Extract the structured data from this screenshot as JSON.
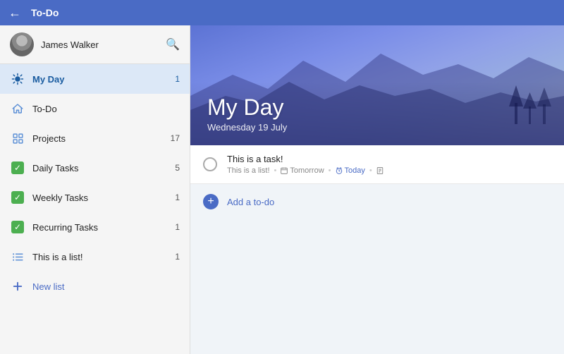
{
  "topbar": {
    "title": "To-Do"
  },
  "sidebar": {
    "user": {
      "name": "James Walker"
    },
    "items": [
      {
        "id": "my-day",
        "label": "My Day",
        "icon": "sun",
        "count": "1",
        "active": true
      },
      {
        "id": "to-do",
        "label": "To-Do",
        "icon": "house",
        "count": "",
        "active": false
      },
      {
        "id": "projects",
        "label": "Projects",
        "icon": "grid",
        "count": "17",
        "active": false
      },
      {
        "id": "daily-tasks",
        "label": "Daily Tasks",
        "icon": "check",
        "count": "5",
        "active": false
      },
      {
        "id": "weekly-tasks",
        "label": "Weekly Tasks",
        "icon": "check",
        "count": "1",
        "active": false
      },
      {
        "id": "recurring-tasks",
        "label": "Recurring Tasks",
        "icon": "check",
        "count": "1",
        "active": false
      },
      {
        "id": "this-is-a-list",
        "label": "This is a list!",
        "icon": "list",
        "count": "1",
        "active": false
      }
    ],
    "new_list_label": "New list"
  },
  "content": {
    "header": {
      "title": "My Day",
      "date": "Wednesday 19 July"
    },
    "tasks": [
      {
        "id": "task-1",
        "title": "This is a task!",
        "list": "This is a list!",
        "due": "Tomorrow",
        "reminder": "Today",
        "has_note": true
      }
    ],
    "add_todo_label": "Add a to-do"
  }
}
